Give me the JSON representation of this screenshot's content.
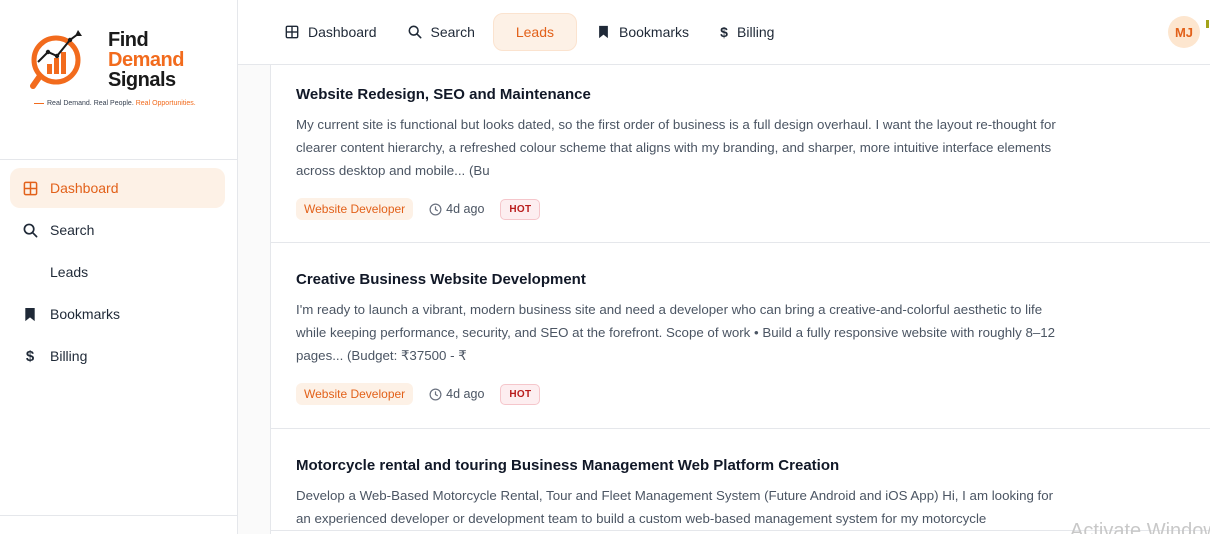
{
  "brand": {
    "line1": "Find",
    "line2": "Demand",
    "line3": "Signals",
    "tagline_a": "Real Demand. Real People.",
    "tagline_b": "Real Opportunities.",
    "accent_color": "#f26b1d"
  },
  "sidebar": {
    "items": [
      {
        "label": "Dashboard",
        "icon": "grid-icon",
        "active": true
      },
      {
        "label": "Search",
        "icon": "search-icon",
        "active": false
      },
      {
        "label": "Leads",
        "icon": "",
        "active": false
      },
      {
        "label": "Bookmarks",
        "icon": "bookmark-icon",
        "active": false
      },
      {
        "label": "Billing",
        "icon": "dollar-icon",
        "active": false
      }
    ]
  },
  "topnav": {
    "items": [
      {
        "label": "Dashboard",
        "icon": "grid-icon"
      },
      {
        "label": "Search",
        "icon": "search-icon"
      },
      {
        "label": "Leads",
        "icon": "",
        "active": true
      },
      {
        "label": "Bookmarks",
        "icon": "bookmark-icon"
      },
      {
        "label": "Billing",
        "icon": "dollar-icon"
      }
    ],
    "avatar_initials": "MJ"
  },
  "leads": [
    {
      "title": "Website Redesign, SEO and Maintenance",
      "description": "My current site is functional but looks dated, so the first order of business is a full design overhaul. I want the layout re-thought for clearer content hierarchy, a refreshed colour scheme that aligns with my branding, and sharper, more intuitive interface elements across desktop and mobile... (Bu",
      "tag": "Website Developer",
      "time": "4d ago",
      "badge": "HOT"
    },
    {
      "title": "Creative Business Website Development",
      "description": "I'm ready to launch a vibrant, modern business site and need a developer who can bring a creative-and-colorful aesthetic to life while keeping performance, security, and SEO at the forefront. Scope of work • Build a fully responsive website with roughly 8–12 pages... (Budget: ₹37500 - ₹",
      "tag": "Website Developer",
      "time": "4d ago",
      "badge": "HOT"
    },
    {
      "title": "Motorcycle rental and touring Business Management Web Platform Creation",
      "description": "Develop a Web-Based Motorcycle Rental, Tour and Fleet Management System (Future Android and iOS App) Hi, I am looking for an experienced developer or development team to build a custom web-based management system for my motorcycle",
      "tag": "",
      "time": "",
      "badge": ""
    }
  ],
  "watermark": "Activate Windows"
}
